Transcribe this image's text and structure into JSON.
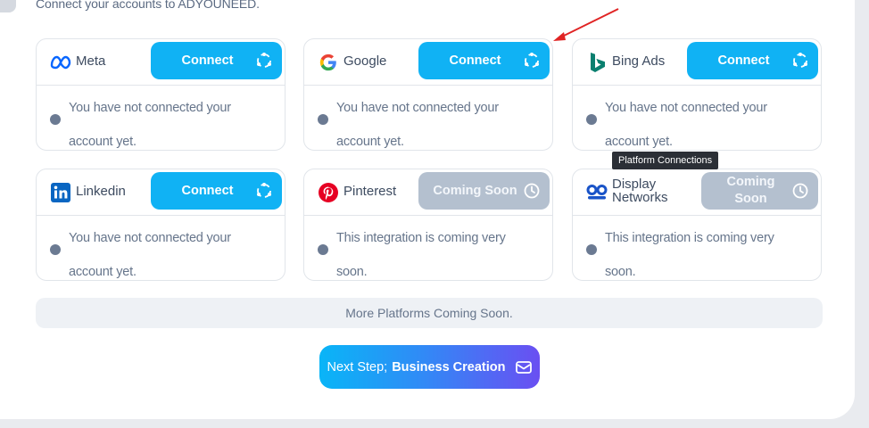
{
  "subtitle": "Connect your accounts to ADYOUNEED.",
  "platforms": {
    "meta": {
      "name": "Meta",
      "button": "Connect",
      "status": "You have not connected your account yet."
    },
    "google": {
      "name": "Google",
      "button": "Connect",
      "status": "You have not connected your account yet."
    },
    "bing": {
      "name": "Bing Ads",
      "button": "Connect",
      "status": "You have not connected your account yet."
    },
    "linkedin": {
      "name": "Linkedin",
      "button": "Connect",
      "status": "You have not connected your account yet."
    },
    "pinterest": {
      "name": "Pinterest",
      "button": "Coming Soon",
      "status": "This integration is coming very soon."
    },
    "display": {
      "name": "Display Networks",
      "button": "Coming Soon",
      "status": "This integration is coming very soon."
    }
  },
  "tooltip": "Platform Connections",
  "more_platforms": "More Platforms Coming Soon.",
  "next_step": {
    "prefix": "Next Step;",
    "bold": "Business Creation"
  },
  "colors": {
    "connect": "#10b2f4",
    "coming_soon": "#b4c0cf",
    "annotation_arrow": "#e02424"
  },
  "icons": {
    "connect": "sync-icon",
    "coming_soon": "clock-icon",
    "next": "mail-icon"
  }
}
